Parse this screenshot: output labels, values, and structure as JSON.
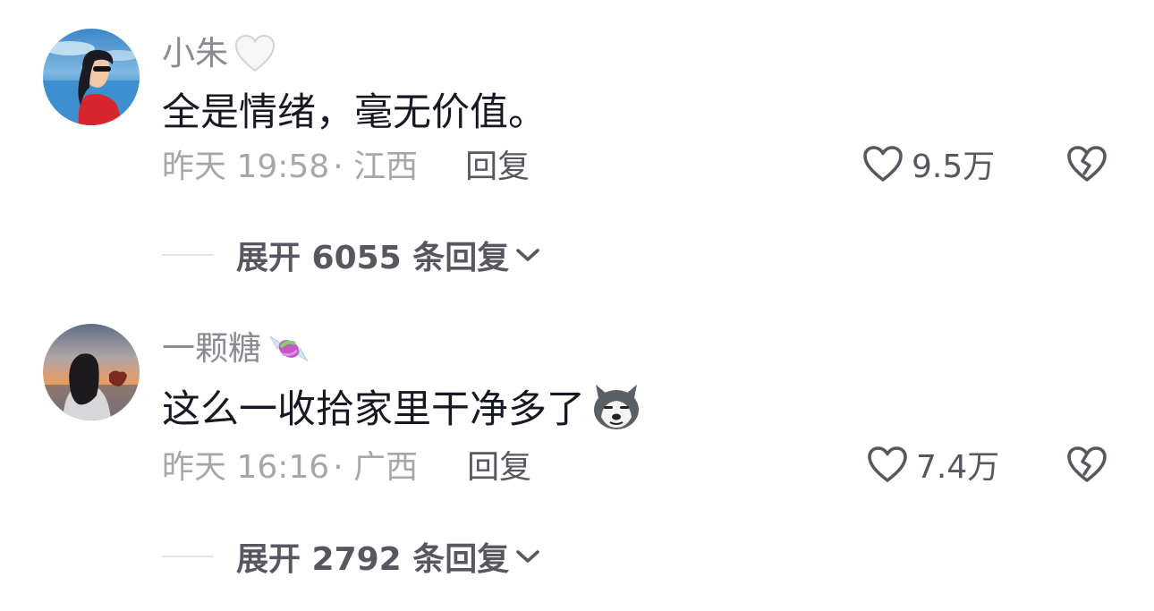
{
  "colors": {
    "username": "#8a8b91",
    "text": "#161823",
    "meta": "#a6a7ab",
    "action": "#57585f",
    "divider": "#e3e3e5"
  },
  "comments": [
    {
      "username": "小朱",
      "name_emoji": "white-heart-icon",
      "text": "全是情绪，毫无价值。",
      "text_emoji": null,
      "time": "昨天 19:58",
      "region": "· 江西",
      "reply_label": "回复",
      "likes": "9.5万",
      "expand_label": "展开 6055 条回复"
    },
    {
      "username": "一颗糖",
      "name_emoji": "candy-icon",
      "text": "这么一收拾家里干净多了",
      "text_emoji": "husky-dog-icon",
      "time": "昨天 16:16",
      "region": "· 广西",
      "reply_label": "回复",
      "likes": "7.4万",
      "expand_label": "展开 2792 条回复"
    }
  ]
}
